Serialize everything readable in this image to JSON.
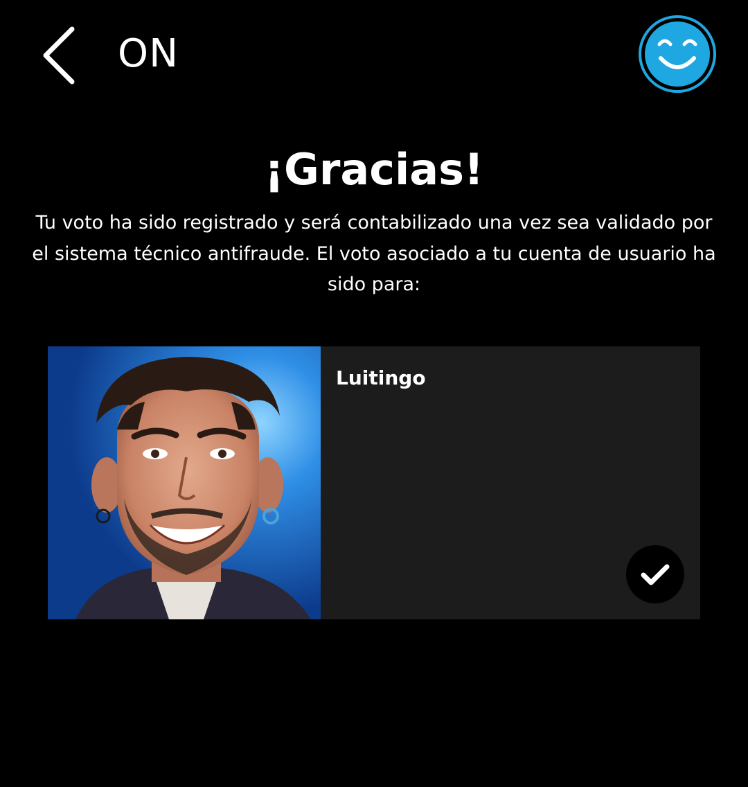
{
  "header": {
    "title": "ON",
    "back_icon": "chevron-left-icon",
    "avatar_icon": "smiley-face-icon",
    "avatar_color": "#1ea7e0"
  },
  "confirmation": {
    "title": "¡Gracias!",
    "message": "Tu voto ha sido registrado y será contabilizado una vez sea validado por el sistema técnico antifraude. El voto asociado a tu cuenta de usuario ha sido para:"
  },
  "vote_card": {
    "candidate_name": "Luitingo",
    "selected": true,
    "check_icon": "checkmark-icon",
    "card_color": "#1c1c1c"
  }
}
